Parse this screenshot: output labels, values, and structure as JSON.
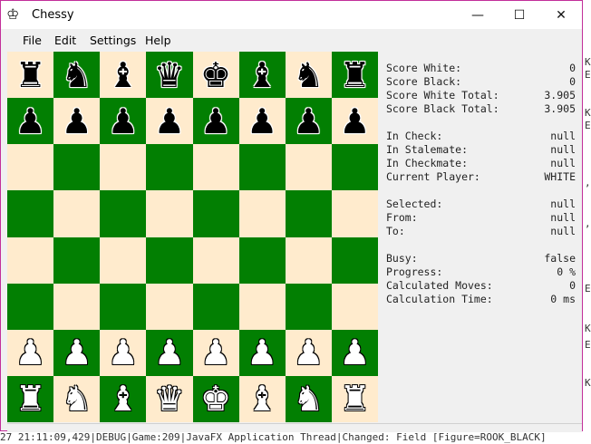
{
  "window": {
    "title": "Chessy",
    "icon": "chess-king-icon",
    "controls": {
      "minimize": "—",
      "maximize": "☐",
      "close": "✕"
    }
  },
  "menu": [
    "File",
    "Edit",
    "Settings",
    "Help"
  ],
  "colors": {
    "light_square": "#ffebcd",
    "dark_square": "#027f02"
  },
  "board": {
    "rows": [
      [
        "br",
        "bn",
        "bb",
        "bq",
        "bk",
        "bb",
        "bn",
        "br"
      ],
      [
        "bp",
        "bp",
        "bp",
        "bp",
        "bp",
        "bp",
        "bp",
        "bp"
      ],
      [
        "",
        "",
        "",
        "",
        "",
        "",
        "",
        ""
      ],
      [
        "",
        "",
        "",
        "",
        "",
        "",
        "",
        ""
      ],
      [
        "",
        "",
        "",
        "",
        "",
        "",
        "",
        ""
      ],
      [
        "",
        "",
        "",
        "",
        "",
        "",
        "",
        ""
      ],
      [
        "wp",
        "wp",
        "wp",
        "wp",
        "wp",
        "wp",
        "wp",
        "wp"
      ],
      [
        "wr",
        "wn",
        "wb",
        "wq",
        "wk",
        "wb",
        "wn",
        "wr"
      ]
    ]
  },
  "info": {
    "score_white": {
      "label": "Score White:",
      "value": "0"
    },
    "score_black": {
      "label": "Score Black:",
      "value": "0"
    },
    "score_white_total": {
      "label": "Score White Total:",
      "value": "3.905"
    },
    "score_black_total": {
      "label": "Score Black Total:",
      "value": "3.905"
    },
    "in_check": {
      "label": "In Check:",
      "value": "null"
    },
    "in_stalemate": {
      "label": "In Stalemate:",
      "value": "null"
    },
    "in_checkmate": {
      "label": "In Checkmate:",
      "value": "null"
    },
    "current_player": {
      "label": "Current Player:",
      "value": "WHITE"
    },
    "selected": {
      "label": "Selected:",
      "value": "null"
    },
    "from": {
      "label": "From:",
      "value": "null"
    },
    "to": {
      "label": "To:",
      "value": "null"
    },
    "busy": {
      "label": "Busy:",
      "value": "false"
    },
    "progress": {
      "label": "Progress:",
      "value": "0 %"
    },
    "calculated_moves": {
      "label": "Calculated Moves:",
      "value": "0"
    },
    "calculation_time": {
      "label": "Calculation Time:",
      "value": "0 ms"
    }
  },
  "background": {
    "console_line": "27 21:11:09,429|DEBUG|Game:209|JavaFX Application Thread|Changed: Field [Figure=ROOK_BLACK]",
    "side_chars": [
      "K",
      "E",
      "K",
      "E",
      ",",
      ",",
      "E",
      "K",
      "E",
      "K"
    ]
  }
}
